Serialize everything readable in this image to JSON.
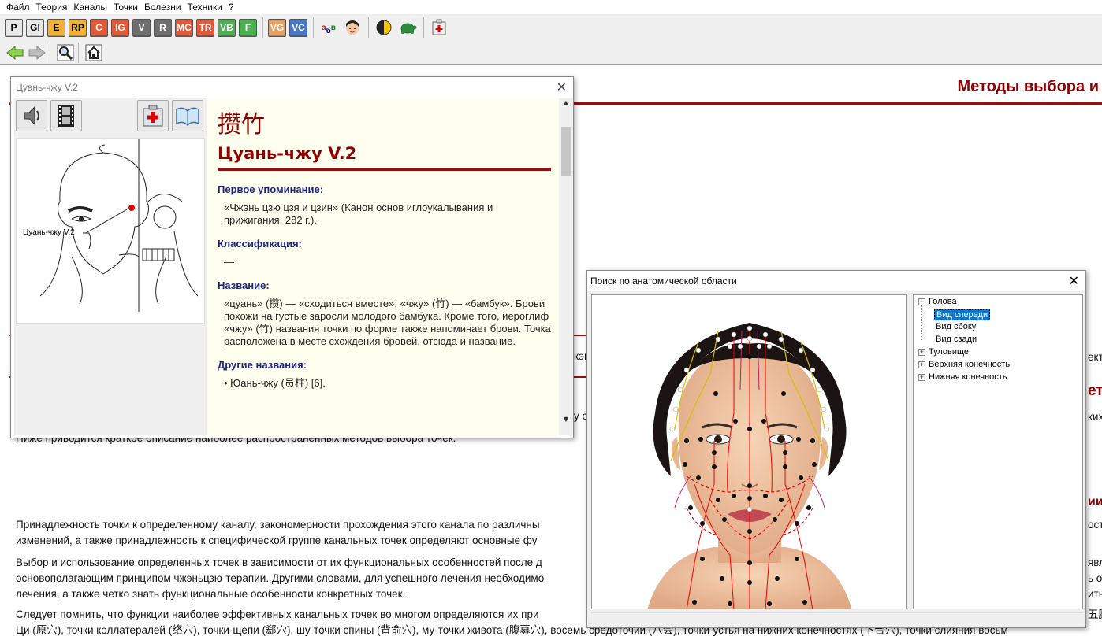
{
  "menu": [
    "Файл",
    "Теория",
    "Каналы",
    "Точки",
    "Болезни",
    "Техники",
    "?"
  ],
  "toolbar_channels": [
    {
      "label": "P",
      "bg": "#e8e8e8",
      "fg": "#000"
    },
    {
      "label": "GI",
      "bg": "#e8e8e8",
      "fg": "#000"
    },
    {
      "label": "E",
      "bg": "#f2b134",
      "fg": "#000"
    },
    {
      "label": "RP",
      "bg": "#f2b134",
      "fg": "#000"
    },
    {
      "label": "C",
      "bg": "#e05a3a",
      "fg": "#fff"
    },
    {
      "label": "IG",
      "bg": "#e05a3a",
      "fg": "#fff"
    },
    {
      "label": "V",
      "bg": "#6f6f6f",
      "fg": "#fff"
    },
    {
      "label": "R",
      "bg": "#6f6f6f",
      "fg": "#fff"
    },
    {
      "label": "MC",
      "bg": "#e05a3a",
      "fg": "#fff"
    },
    {
      "label": "TR",
      "bg": "#e05a3a",
      "fg": "#fff"
    },
    {
      "label": "VB",
      "bg": "#4caf50",
      "fg": "#fff"
    },
    {
      "label": "F",
      "bg": "#4caf50",
      "fg": "#fff"
    }
  ],
  "toolbar_extra": [
    {
      "label": "VG",
      "bg": "#e8a060",
      "fg": "#fff"
    },
    {
      "label": "VC",
      "bg": "#4a78c8",
      "fg": "#fff"
    }
  ],
  "main": {
    "title": "Методы выбора и",
    "paragraphs": [
      "Ниже приводится краткое описание наиболее распространенных методов выбора точек.",
      "Принадлежность точки к определенному каналу, закономерности прохождения этого канала по различны",
      "изменений, а также принадлежность к специфической группе канальных точек определяют основные фу",
      "Выбор и использование определенных точек в зависимости от их функциональных особенностей после д",
      "основополагающим принципом чжэньцзю-терапии. Другими словами, для успешного лечения необходимо",
      "лечения, а также четко знать функциональные особенности конкретных точек.",
      "Следует помнить, что функции наиболее эффективных канальных точек во многом определяются их при",
      "Ци (原穴), точки коллатералей (络穴), точки-щепи (郄穴), шу-точки спины (背俞穴), му-точки живота (腹募穴), восемь средоточий (八会), точки-устья на нижних конечностях (下合穴), точки слияния восьм"
    ],
    "right_fragments": [
      "ект",
      "ето",
      "ких",
      "ии",
      "ость",
      "явл",
      "ь о",
      "ить",
      "五臟"
    ],
    "left_fragments": [
      "кэн",
      "у с"
    ]
  },
  "point_window": {
    "title": "Цуань-чжу V.2",
    "figure_label": "Цуань-чжу V.2",
    "hanzi": "攒竹",
    "name": "Цуань-чжу V.2",
    "sections": [
      {
        "heading": "Первое упоминание:",
        "text": "«Чжэнь цзю цзя и цзин» (Канон основ иглоукалывания и прижигания, 282 г.)."
      },
      {
        "heading": "Классификация:",
        "text": "—"
      },
      {
        "heading": "Название:",
        "text": "«цуань» (攒) — «сходиться вместе»; «чжу» (竹) — «бамбук». Брови похожи на густые заросли молодого бамбука. Кроме того, иероглиф «чжу» (竹) названия точки по форме также напоминает брови. Точка расположена в месте схождения бровей, отсюда и название."
      },
      {
        "heading": "Другие названия:",
        "text": "• Юань-чжу (员柱) [6]."
      }
    ]
  },
  "search_window": {
    "title": "Поиск по анатомической области",
    "tree": [
      {
        "label": "Голова",
        "sign": "−"
      },
      {
        "label": "Вид спереди",
        "selected": true
      },
      {
        "label": "Вид сбоку"
      },
      {
        "label": "Вид сзади"
      },
      {
        "label": "Туловище",
        "sign": "+"
      },
      {
        "label": "Верхняя конечность",
        "sign": "+"
      },
      {
        "label": "Нижняя конечность",
        "sign": "+"
      }
    ]
  },
  "colors": {
    "accent": "#8b0000",
    "heading": "#1a237e",
    "paper": "#fffff0"
  }
}
